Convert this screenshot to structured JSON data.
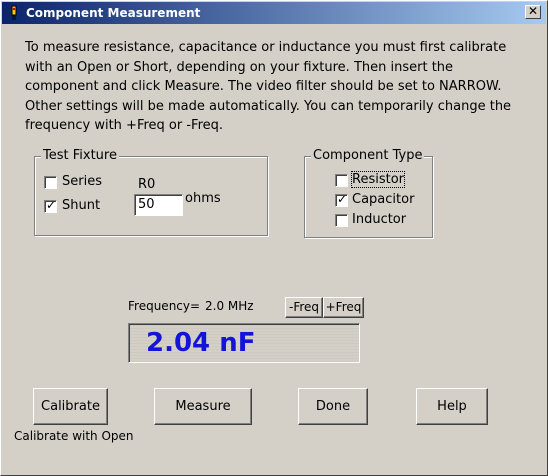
{
  "window": {
    "title": "Component Measurement",
    "close_glyph": "✕"
  },
  "instructions": "To measure resistance, capacitance or inductance you must first calibrate with an Open or Short, depending on your fixture. Then insert the component and click Measure. The video filter should be set to NARROW. Other settings will be made automatically. You can temporarily change the frequency with +Freq or -Freq.",
  "test_fixture": {
    "title": "Test Fixture",
    "series_label": "Series",
    "series_checked": false,
    "shunt_label": "Shunt",
    "shunt_checked": true,
    "r0_label": "R0",
    "r0_value": "50",
    "r0_unit": "ohms"
  },
  "component_type": {
    "title": "Component Type",
    "resistor_label": "Resistor",
    "resistor_checked": false,
    "capacitor_label": "Capacitor",
    "capacitor_checked": true,
    "inductor_label": "Inductor",
    "inductor_checked": false
  },
  "frequency": {
    "label": "Frequency=",
    "value": "2.0 MHz",
    "minus_label": "-Freq",
    "plus_label": "+Freq"
  },
  "reading": {
    "value": "2.04 nF",
    "color": "#1414d8"
  },
  "buttons": {
    "calibrate": "Calibrate",
    "measure": "Measure",
    "done": "Done",
    "help": "Help"
  },
  "status": "Calibrate with Open",
  "icons": {
    "app": "app-icon",
    "checkmark": "✓"
  }
}
